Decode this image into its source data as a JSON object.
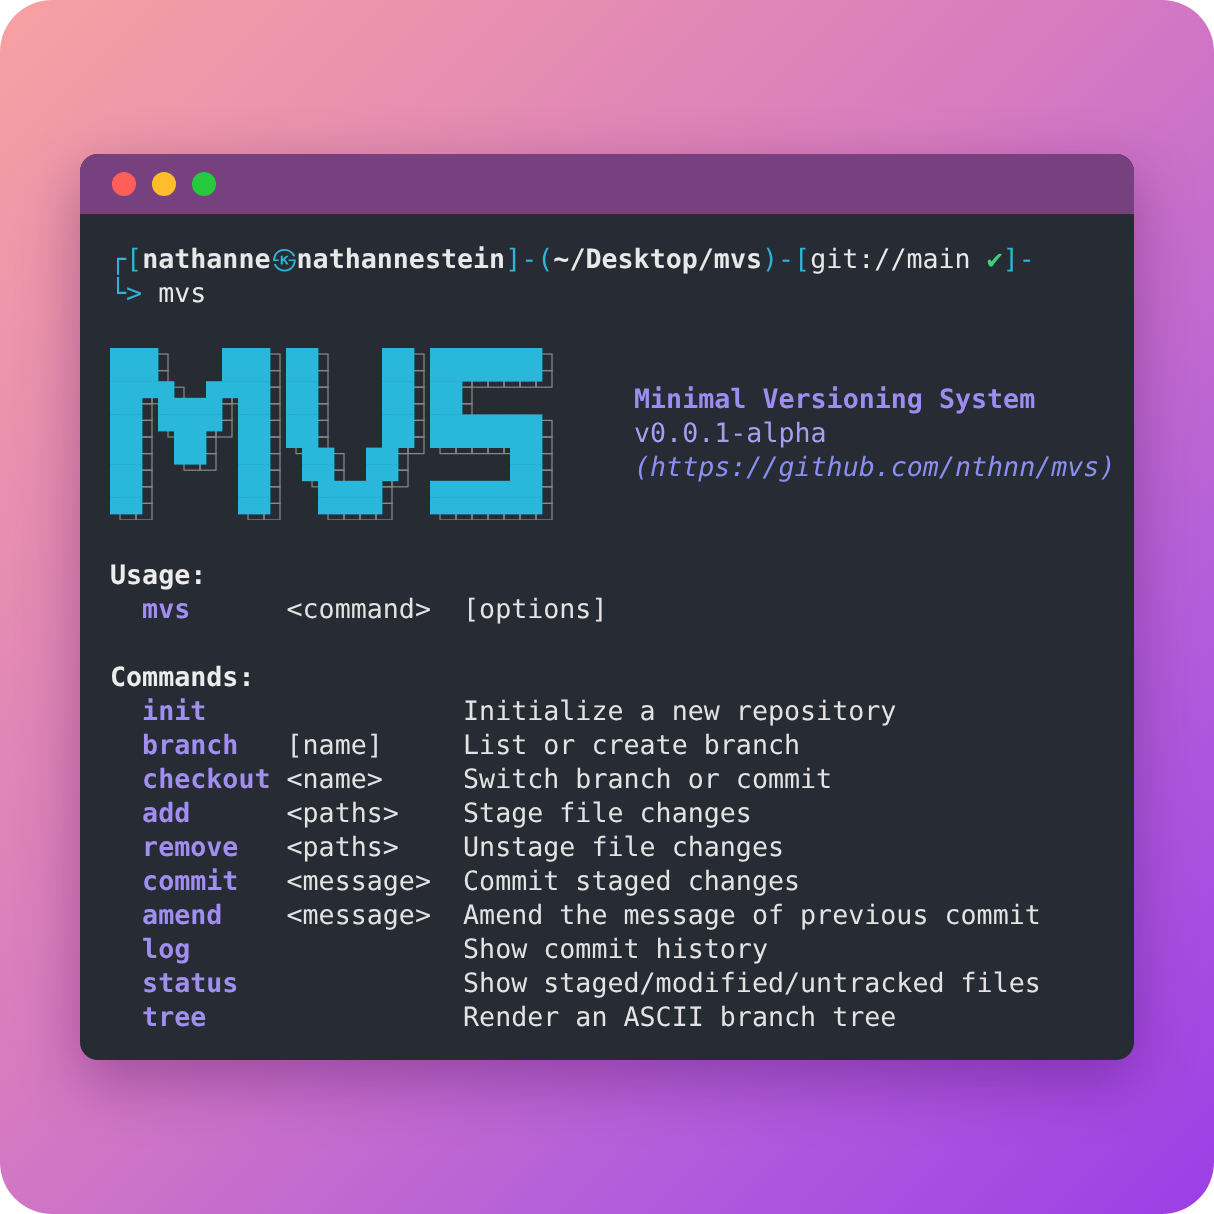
{
  "window": {
    "controls": [
      {
        "color": "#ff5f56"
      },
      {
        "color": "#ffbd2e"
      },
      {
        "color": "#27c93f"
      }
    ]
  },
  "prompt": {
    "line_1": [
      {
        "text": "┌[",
        "kind": "frame"
      },
      {
        "text": "nathanne",
        "kind": "bold"
      },
      {
        "text": "㉿",
        "kind": "frame"
      },
      {
        "text": "nathannestein",
        "kind": "bold"
      },
      {
        "text": "]-(",
        "kind": "frame"
      },
      {
        "text": "~/Desktop/mvs",
        "kind": "bold"
      },
      {
        "text": ")-[",
        "kind": "frame"
      },
      {
        "text": "git://main",
        "kind": "plain"
      },
      {
        "text": "✔",
        "kind": "ok"
      },
      {
        "text": "]-",
        "kind": "frame"
      }
    ],
    "line_2": [
      {
        "text": "└>",
        "kind": "frame"
      },
      {
        "text": "mvs",
        "kind": "plain"
      }
    ]
  },
  "banner": {
    "title": "Minimal Versioning System",
    "version": "v0.0.1-alpha",
    "url": "(https://github.com/nthnn/mvs)"
  },
  "usage": {
    "heading": "Usage:",
    "program": "mvs",
    "argument": "<command>",
    "options": "[options]"
  },
  "commands": {
    "heading": "Commands:",
    "rows": [
      {
        "name": "init",
        "description": "Initialize a new repository"
      },
      {
        "name": "branch",
        "argument": "[name]",
        "description": "List or create branch"
      },
      {
        "name": "checkout",
        "argument": "<name>",
        "description": "Switch branch or commit"
      },
      {
        "name": "add",
        "argument": "<paths>",
        "description": "Stage file changes"
      },
      {
        "name": "remove",
        "argument": "<paths>",
        "description": "Unstage file changes"
      },
      {
        "name": "commit",
        "argument": "<message>",
        "description": "Commit staged changes"
      },
      {
        "name": "amend",
        "argument": "<message>",
        "description": "Amend the message of previous commit"
      },
      {
        "name": "log",
        "description": "Show commit history"
      },
      {
        "name": "status",
        "description": "Show staged/modified/untracked files"
      },
      {
        "name": "tree",
        "description": "Render an ASCII branch tree"
      }
    ]
  }
}
